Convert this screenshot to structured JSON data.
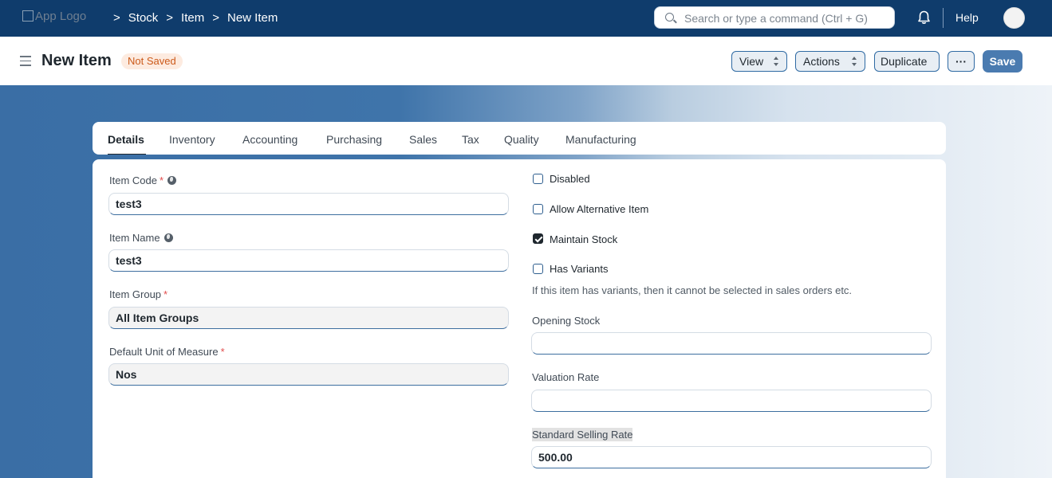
{
  "navbar": {
    "logo_alt": "App Logo",
    "breadcrumbs": [
      "Stock",
      "Item",
      "New Item"
    ],
    "separator": ">",
    "search_placeholder": "Search or type a command (Ctrl + G)",
    "help_label": "Help"
  },
  "page_head": {
    "title": "New Item",
    "status_badge": "Not Saved",
    "view_label": "View",
    "actions_label": "Actions",
    "duplicate_label": "Duplicate",
    "more_label": "···",
    "save_label": "Save"
  },
  "tabs": [
    "Details",
    "Inventory",
    "Accounting",
    "Purchasing",
    "Sales",
    "Tax",
    "Quality",
    "Manufacturing"
  ],
  "form": {
    "item_code": {
      "label": "Item Code",
      "value": "test3",
      "required": "*"
    },
    "item_name": {
      "label": "Item Name",
      "value": "test3"
    },
    "item_group": {
      "label": "Item Group",
      "value": "All Item Groups",
      "required": "*"
    },
    "uom": {
      "label": "Default Unit of Measure",
      "value": "Nos",
      "required": "*"
    },
    "disabled": {
      "label": "Disabled",
      "checked": false
    },
    "allow_alternative": {
      "label": "Allow Alternative Item",
      "checked": false
    },
    "maintain_stock": {
      "label": "Maintain Stock",
      "checked": true
    },
    "has_variants": {
      "label": "Has Variants",
      "checked": false
    },
    "variants_help": "If this item has variants, then it cannot be selected in sales orders etc.",
    "opening_stock": {
      "label": "Opening Stock",
      "value": ""
    },
    "valuation_rate": {
      "label": "Valuation Rate",
      "value": ""
    },
    "standard_selling_rate": {
      "label": "Standard Selling Rate",
      "value": "500.00"
    }
  },
  "colors": {
    "navbar": "#0f3c6c",
    "primary": "#4a7bb0",
    "badge_text": "#cc5a1a",
    "badge_bg": "#fdebe0"
  }
}
